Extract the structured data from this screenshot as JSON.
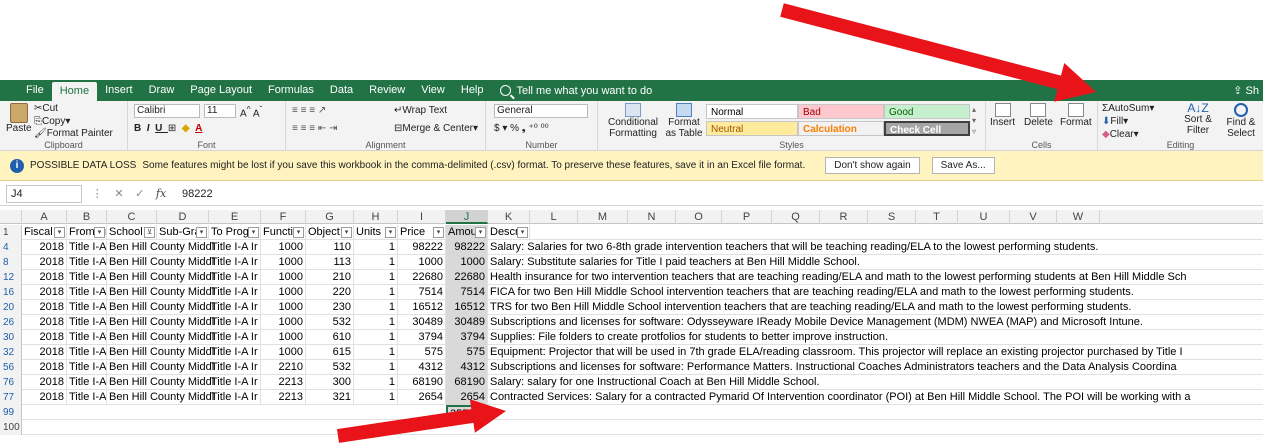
{
  "tabs": [
    "File",
    "Home",
    "Insert",
    "Draw",
    "Page Layout",
    "Formulas",
    "Data",
    "Review",
    "View",
    "Help"
  ],
  "active_tab": "Home",
  "tell_me": "Tell me what you want to do",
  "share": "Sh",
  "ribbon": {
    "clipboard": {
      "paste": "Paste",
      "cut": "Cut",
      "copy": "Copy",
      "format_painter": "Format Painter",
      "label": "Clipboard"
    },
    "font": {
      "family": "Calibri",
      "size": "11",
      "label": "Font"
    },
    "alignment": {
      "wrap": "Wrap Text",
      "merge": "Merge & Center",
      "label": "Alignment"
    },
    "number": {
      "format": "General",
      "label": "Number"
    },
    "styles": {
      "conditional": "Conditional Formatting",
      "format_as_table": "Format as Table",
      "cells": [
        {
          "name": "Normal",
          "bg": "#ffffff",
          "fg": "#000000"
        },
        {
          "name": "Bad",
          "bg": "#ffc7ce",
          "fg": "#9c0006"
        },
        {
          "name": "Good",
          "bg": "#c6efce",
          "fg": "#006100"
        },
        {
          "name": "Neutral",
          "bg": "#ffeb9c",
          "fg": "#9c5700"
        },
        {
          "name": "Calculation",
          "bg": "#f2f2f2",
          "fg": "#fa7d00"
        },
        {
          "name": "Check Cell",
          "bg": "#a5a5a5",
          "fg": "#ffffff"
        }
      ],
      "label": "Styles"
    },
    "cells": {
      "insert": "Insert",
      "delete": "Delete",
      "format": "Format",
      "label": "Cells"
    },
    "editing": {
      "autosum": "AutoSum",
      "fill": "Fill",
      "clear": "Clear",
      "sort_filter": "Sort & Filter",
      "find_select": "Find & Select",
      "label": "Editing"
    }
  },
  "message_bar": {
    "title": "POSSIBLE DATA LOSS",
    "text": "Some features might be lost if you save this workbook in the comma-delimited (.csv) format. To preserve these features, save it in an Excel file format.",
    "dont_show": "Don't show again",
    "save_as": "Save As..."
  },
  "formula_bar": {
    "name_box": "J4",
    "fx": "fx",
    "value": "98222"
  },
  "columns": [
    "A",
    "B",
    "C",
    "D",
    "E",
    "F",
    "G",
    "H",
    "I",
    "J",
    "K",
    "L",
    "M",
    "N",
    "O",
    "P",
    "Q",
    "R",
    "S",
    "T",
    "U",
    "V",
    "W"
  ],
  "header_row": {
    "num": "1",
    "cells": [
      "Fiscal Y",
      "From Pr",
      "School",
      "Sub-Gra",
      "To Prog",
      "Functio",
      "Object",
      "Units",
      "Price",
      "Amount",
      "Descrip"
    ]
  },
  "rows": [
    {
      "num": "4",
      "a": "2018",
      "b": "Title I-A Ir",
      "c": "Ben Hill County Middl",
      "e": "Title I-A Ir",
      "f": "1000",
      "g": "110",
      "h": "1",
      "i": "98222",
      "j": "98222",
      "k": "Salary:  Salaries for two 6-8th grade intervention teachers that will be teaching reading/ELA to the lowest performing students."
    },
    {
      "num": "8",
      "a": "2018",
      "b": "Title I-A Ir",
      "c": "Ben Hill County Middl",
      "e": "Title I-A Ir",
      "f": "1000",
      "g": "113",
      "h": "1",
      "i": "1000",
      "j": "1000",
      "k": "Salary:  Substitute salaries for Title I paid teachers at Ben Hill Middle School."
    },
    {
      "num": "12",
      "a": "2018",
      "b": "Title I-A Ir",
      "c": "Ben Hill County Middl",
      "e": "Title I-A Ir",
      "f": "1000",
      "g": "210",
      "h": "1",
      "i": "22680",
      "j": "22680",
      "k": "Health insurance for two intervention teachers that are teaching reading/ELA and math to the lowest performing students at Ben Hill Middle Sch"
    },
    {
      "num": "16",
      "a": "2018",
      "b": "Title I-A Ir",
      "c": "Ben Hill County Middl",
      "e": "Title I-A Ir",
      "f": "1000",
      "g": "220",
      "h": "1",
      "i": "7514",
      "j": "7514",
      "k": "FICA for two Ben Hill Middle School intervention teachers that are teaching reading/ELA and math to the lowest performing students."
    },
    {
      "num": "20",
      "a": "2018",
      "b": "Title I-A Ir",
      "c": "Ben Hill County Middl",
      "e": "Title I-A Ir",
      "f": "1000",
      "g": "230",
      "h": "1",
      "i": "16512",
      "j": "16512",
      "k": "TRS for two Ben Hill Middle School intervention teachers that are teaching reading/ELA and math to the lowest performing students."
    },
    {
      "num": "26",
      "a": "2018",
      "b": "Title I-A Ir",
      "c": "Ben Hill County Middl",
      "e": "Title I-A Ir",
      "f": "1000",
      "g": "532",
      "h": "1",
      "i": "30489",
      "j": "30489",
      "k": "Subscriptions and licenses for software:  Odysseyware  IReady  Mobile Device Management (MDM)  NWEA (MAP)  and Microsoft Intune."
    },
    {
      "num": "30",
      "a": "2018",
      "b": "Title I-A Ir",
      "c": "Ben Hill County Middl",
      "e": "Title I-A Ir",
      "f": "1000",
      "g": "610",
      "h": "1",
      "i": "3794",
      "j": "3794",
      "k": "Supplies:  File folders to create protfolios for students to better improve instruction."
    },
    {
      "num": "32",
      "a": "2018",
      "b": "Title I-A Ir",
      "c": "Ben Hill County Middl",
      "e": "Title I-A Ir",
      "f": "1000",
      "g": "615",
      "h": "1",
      "i": "575",
      "j": "575",
      "k": "Equipment:  Projector that will be used in 7th grade ELA/reading classroom.  This projector will replace an existing projector purchased by Title I"
    },
    {
      "num": "56",
      "a": "2018",
      "b": "Title I-A Ir",
      "c": "Ben Hill County Middl",
      "e": "Title I-A Ir",
      "f": "2210",
      "g": "532",
      "h": "1",
      "i": "4312",
      "j": "4312",
      "k": "Subscriptions and licenses for software:  Performance Matters.  Instructional Coaches  Administrators  teachers  and the Data Analysis Coordina"
    },
    {
      "num": "76",
      "a": "2018",
      "b": "Title I-A Ir",
      "c": "Ben Hill County Middl",
      "e": "Title I-A Ir",
      "f": "2213",
      "g": "300",
      "h": "1",
      "i": "68190",
      "j": "68190",
      "k": "Salary:  salary for one Instructional Coach at Ben Hill Middle School."
    },
    {
      "num": "77",
      "a": "2018",
      "b": "Title I-A Ir",
      "c": "Ben Hill County Middl",
      "e": "Title I-A Ir",
      "f": "2213",
      "g": "321",
      "h": "1",
      "i": "2654",
      "j": "2654",
      "k": "Contracted Services:  Salary for a contracted Pymarid Of Intervention coordinator (POI) at Ben Hill Middle School.  The POI will be working with a"
    }
  ],
  "sum_row": {
    "num": "99",
    "value": "255942"
  },
  "last_row": {
    "num": "100"
  },
  "arrow_color": "#e8141a"
}
